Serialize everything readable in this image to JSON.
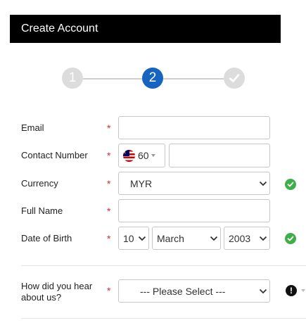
{
  "header": {
    "title": "Create Account"
  },
  "stepper": {
    "steps": [
      {
        "label": "1",
        "state": "done"
      },
      {
        "label": "2",
        "state": "active"
      },
      {
        "label": "",
        "state": "pending",
        "icon": "check-icon"
      }
    ],
    "colors": {
      "active": "#1565c0",
      "inactive": "#dcdcdc",
      "line": "#cfcfcf"
    }
  },
  "form": {
    "required_mark": "*",
    "email": {
      "label": "Email",
      "value": "",
      "placeholder": ""
    },
    "contact": {
      "label": "Contact Number",
      "country_code": "60",
      "country_flag": "malaysia-flag-icon",
      "value": ""
    },
    "currency": {
      "label": "Currency",
      "value": "MYR",
      "status": "valid"
    },
    "full_name": {
      "label": "Full Name",
      "value": ""
    },
    "dob": {
      "label": "Date of Birth",
      "day": "10",
      "month": "March",
      "year": "2003",
      "status": "valid"
    },
    "referral": {
      "label_line1": "How did you hear",
      "label_line2": "about us?",
      "value": "--- Please Select ---",
      "status": "error"
    }
  },
  "colors": {
    "required": "#d32f2f",
    "valid": "#3fae49",
    "error": "#111111"
  }
}
